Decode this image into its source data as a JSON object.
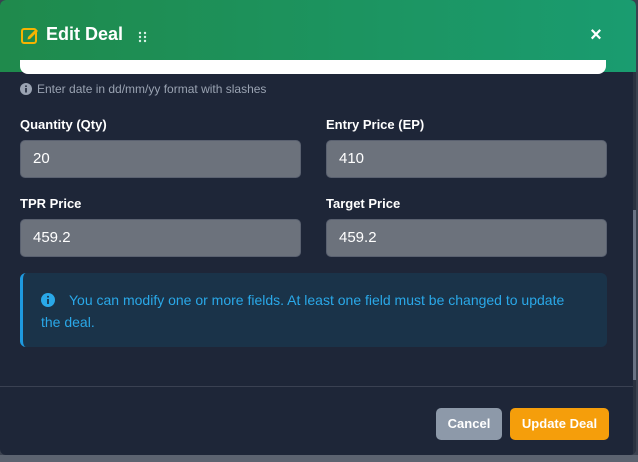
{
  "header": {
    "title": "Edit Deal",
    "close_label": "×"
  },
  "date_hint": "Enter date in dd/mm/yy format with slashes",
  "fields": {
    "quantity": {
      "label": "Quantity (Qty)",
      "value": "20"
    },
    "entry_price": {
      "label": "Entry Price (EP)",
      "value": "410"
    },
    "tpr_price": {
      "label": "TPR Price",
      "value": "459.2"
    },
    "target_price": {
      "label": "Target Price",
      "value": "459.2"
    }
  },
  "info_message": "You can modify one or more fields. At least one field must be changed to update the deal.",
  "footer": {
    "cancel_label": "Cancel",
    "update_label": "Update Deal"
  },
  "colors": {
    "header_green": "#1f8a4c",
    "accent_orange": "#f59e0b",
    "info_blue": "#2aa8e8"
  }
}
